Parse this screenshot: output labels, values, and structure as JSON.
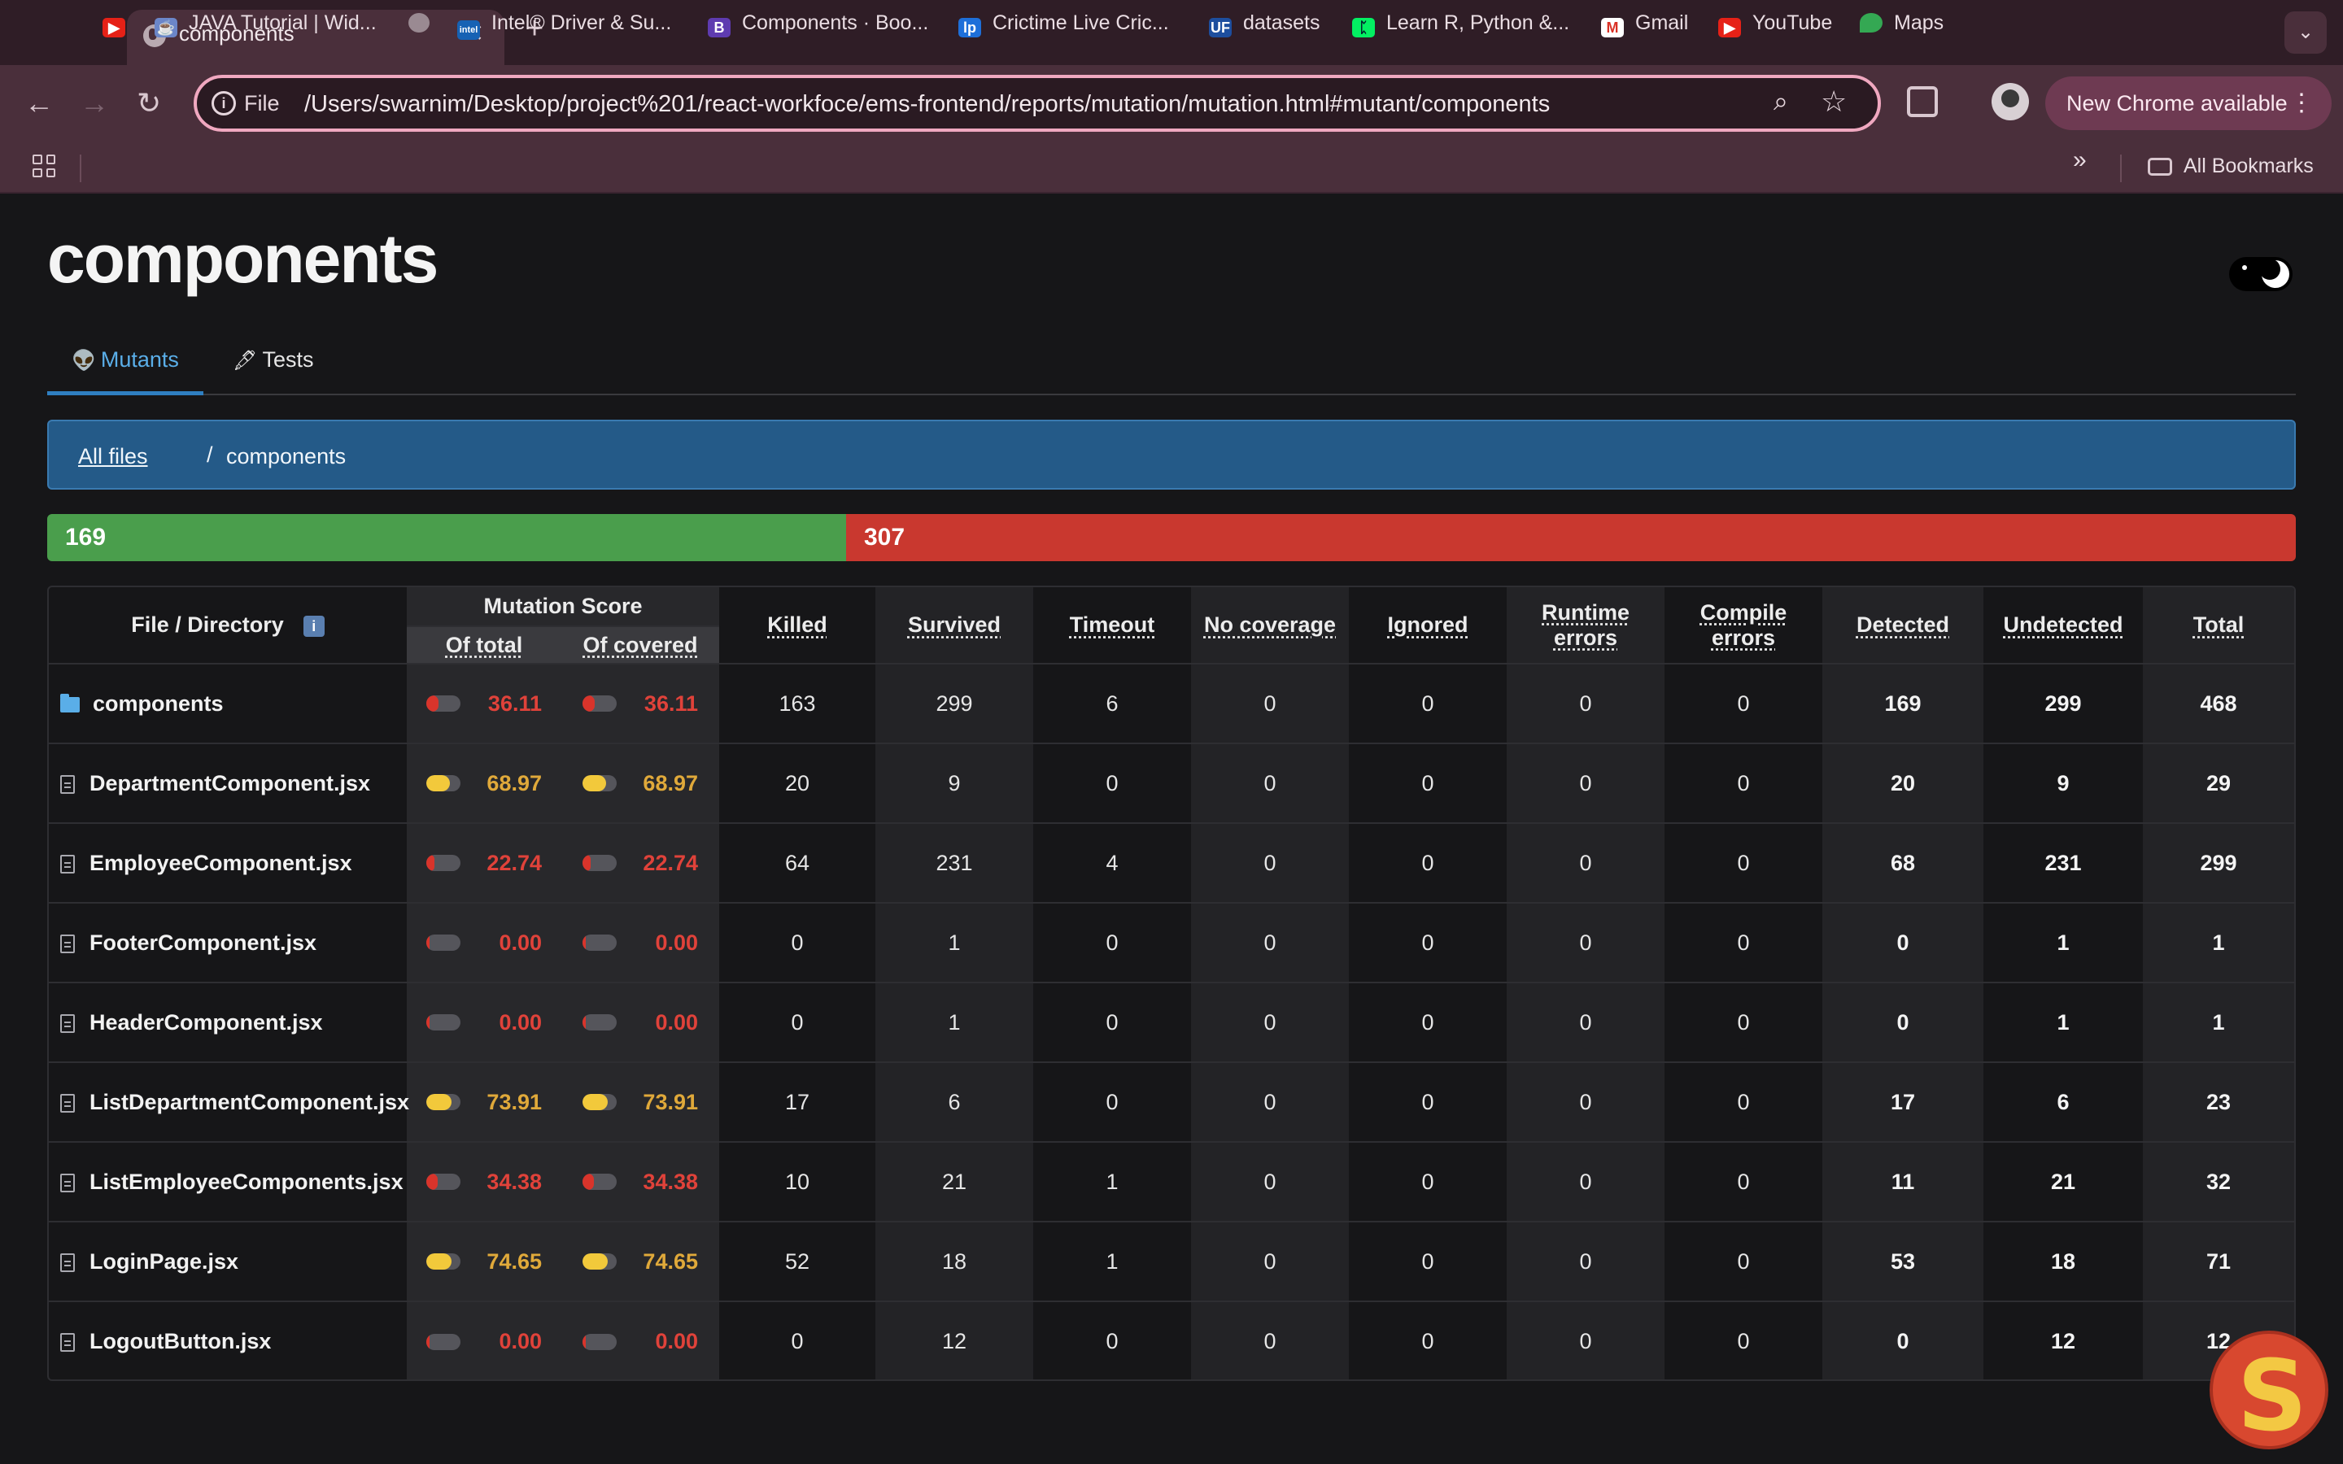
{
  "browser": {
    "tab_title": "components",
    "tab_close": "✕",
    "new_tab": "+",
    "tab_menu": "⌄",
    "scheme": "File",
    "url": "/Users/swarnim/Desktop/project%201/react-workfoce/ems-frontend/reports/mutation/mutation.html#mutant/components",
    "new_chrome": "New Chrome available",
    "bookmarks": [
      {
        "label": "JAVA Tutorial | Wid...",
        "icon": "java-icon"
      },
      {
        "label": "",
        "icon": "globe-icon"
      },
      {
        "label": "Intel® Driver & Su...",
        "icon": "intel-icon"
      },
      {
        "label": "Components · Boo...",
        "icon": "bootstrap-icon"
      },
      {
        "label": "Crictime Live Cric...",
        "icon": "crictime-icon"
      },
      {
        "label": "datasets",
        "icon": "uf-icon"
      },
      {
        "label": "Learn R, Python &...",
        "icon": "datacamp-icon"
      },
      {
        "label": "Gmail",
        "icon": "gmail-icon"
      },
      {
        "label": "YouTube",
        "icon": "youtube-icon"
      },
      {
        "label": "Maps",
        "icon": "maps-icon"
      }
    ],
    "more": "»",
    "all_bookmarks": "All Bookmarks"
  },
  "page": {
    "title": "components",
    "tabs": {
      "mutants": {
        "icon": "👽",
        "label": "Mutants"
      },
      "tests": {
        "icon": "🖋",
        "label": "Tests"
      }
    },
    "breadcrumb": {
      "root": "All files",
      "separator": "/",
      "current": "components"
    },
    "progress": {
      "detected": "169",
      "undetected": "307",
      "detected_color": "#4a9e4c",
      "undetected_color": "#c9382f"
    }
  },
  "table": {
    "headers": {
      "file": "File / Directory",
      "info": "i",
      "mutation_score": "Mutation Score",
      "of_total": "Of total",
      "of_covered": "Of covered",
      "killed": "Killed",
      "survived": "Survived",
      "timeout": "Timeout",
      "no_coverage": "No coverage",
      "ignored": "Ignored",
      "runtime_1": "Runtime",
      "runtime_2": "errors",
      "compile_1": "Compile",
      "compile_2": "errors",
      "detected": "Detected",
      "undetected": "Undetected",
      "total": "Total"
    },
    "rows": [
      {
        "name": "components",
        "type": "folder",
        "level": "red",
        "score_total": "36.11",
        "score_covered": "36.11",
        "killed": "163",
        "survived": "299",
        "timeout": "6",
        "no_coverage": "0",
        "ignored": "0",
        "runtime": "0",
        "compile": "0",
        "detected": "169",
        "undetected": "299",
        "total": "468"
      },
      {
        "name": "DepartmentComponent.jsx",
        "type": "file",
        "level": "yellow",
        "score_total": "68.97",
        "score_covered": "68.97",
        "killed": "20",
        "survived": "9",
        "timeout": "0",
        "no_coverage": "0",
        "ignored": "0",
        "runtime": "0",
        "compile": "0",
        "detected": "20",
        "undetected": "9",
        "total": "29"
      },
      {
        "name": "EmployeeComponent.jsx",
        "type": "file",
        "level": "red",
        "score_total": "22.74",
        "score_covered": "22.74",
        "killed": "64",
        "survived": "231",
        "timeout": "4",
        "no_coverage": "0",
        "ignored": "0",
        "runtime": "0",
        "compile": "0",
        "detected": "68",
        "undetected": "231",
        "total": "299"
      },
      {
        "name": "FooterComponent.jsx",
        "type": "file",
        "level": "red",
        "score_total": "0.00",
        "score_covered": "0.00",
        "killed": "0",
        "survived": "1",
        "timeout": "0",
        "no_coverage": "0",
        "ignored": "0",
        "runtime": "0",
        "compile": "0",
        "detected": "0",
        "undetected": "1",
        "total": "1"
      },
      {
        "name": "HeaderComponent.jsx",
        "type": "file",
        "level": "red",
        "score_total": "0.00",
        "score_covered": "0.00",
        "killed": "0",
        "survived": "1",
        "timeout": "0",
        "no_coverage": "0",
        "ignored": "0",
        "runtime": "0",
        "compile": "0",
        "detected": "0",
        "undetected": "1",
        "total": "1"
      },
      {
        "name": "ListDepartmentComponent.jsx",
        "type": "file",
        "level": "yellow",
        "score_total": "73.91",
        "score_covered": "73.91",
        "killed": "17",
        "survived": "6",
        "timeout": "0",
        "no_coverage": "0",
        "ignored": "0",
        "runtime": "0",
        "compile": "0",
        "detected": "17",
        "undetected": "6",
        "total": "23"
      },
      {
        "name": "ListEmployeeComponents.jsx",
        "type": "file",
        "level": "red",
        "score_total": "34.38",
        "score_covered": "34.38",
        "killed": "10",
        "survived": "21",
        "timeout": "1",
        "no_coverage": "0",
        "ignored": "0",
        "runtime": "0",
        "compile": "0",
        "detected": "11",
        "undetected": "21",
        "total": "32"
      },
      {
        "name": "LoginPage.jsx",
        "type": "file",
        "level": "yellow",
        "score_total": "74.65",
        "score_covered": "74.65",
        "killed": "52",
        "survived": "18",
        "timeout": "1",
        "no_coverage": "0",
        "ignored": "0",
        "runtime": "0",
        "compile": "0",
        "detected": "53",
        "undetected": "18",
        "total": "71"
      },
      {
        "name": "LogoutButton.jsx",
        "type": "file",
        "level": "red",
        "score_total": "0.00",
        "score_covered": "0.00",
        "killed": "0",
        "survived": "12",
        "timeout": "0",
        "no_coverage": "0",
        "ignored": "0",
        "runtime": "0",
        "compile": "0",
        "detected": "0",
        "undetected": "12",
        "total": "12"
      }
    ]
  },
  "badge": {
    "letter": "S"
  }
}
